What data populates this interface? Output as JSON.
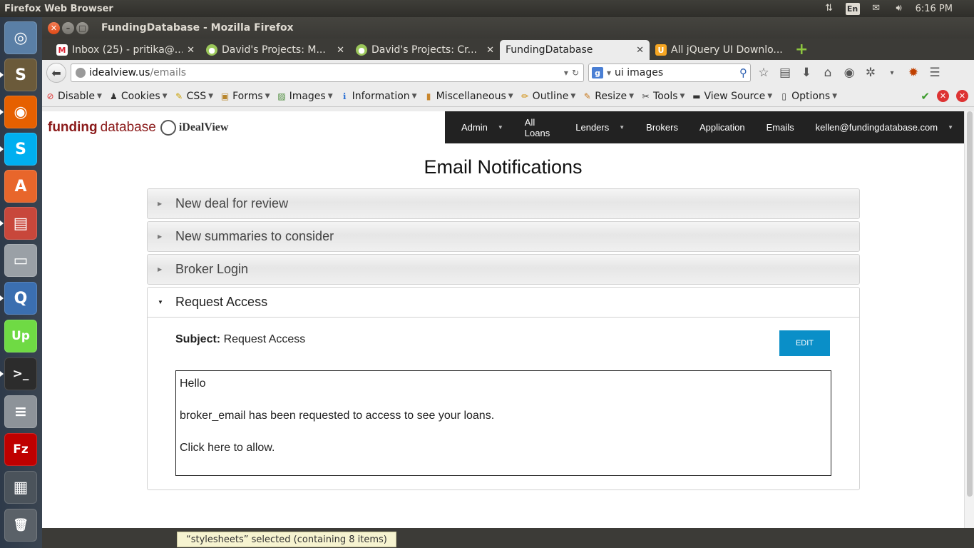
{
  "desktop": {
    "panel_title": "Firefox Web Browser",
    "time": "6:16 PM",
    "keyboard_layout": "En",
    "tray_icons": [
      "network-icon",
      "keyboard-icon",
      "mail-icon",
      "volume-icon"
    ]
  },
  "launcher": {
    "items": [
      {
        "name": "ubuntu-dash-icon",
        "glyph": "◎",
        "color": "#5a7fa6"
      },
      {
        "name": "sublime-text-icon",
        "glyph": "S",
        "color": "#6b5a3a"
      },
      {
        "name": "firefox-icon",
        "glyph": "◉",
        "color": "#e66000"
      },
      {
        "name": "skype-icon",
        "glyph": "S",
        "color": "#00aff0"
      },
      {
        "name": "software-center-icon",
        "glyph": "A",
        "color": "#e8662b"
      },
      {
        "name": "file-manager-icon",
        "glyph": "▤",
        "color": "#c8473b"
      },
      {
        "name": "disk-icon",
        "glyph": "▭",
        "color": "#9aa0a6"
      },
      {
        "name": "quassel-icon",
        "glyph": "Q",
        "color": "#3b6fb0"
      },
      {
        "name": "upwork-icon",
        "glyph": "Up",
        "color": "#6fda44"
      },
      {
        "name": "terminal-icon",
        "glyph": ">_",
        "color": "#2c2c2c"
      },
      {
        "name": "database-icon",
        "glyph": "≡",
        "color": "#8d9399"
      },
      {
        "name": "filezilla-icon",
        "glyph": "Fz",
        "color": "#bf0000"
      },
      {
        "name": "workspace-switcher-icon",
        "glyph": "▦",
        "color": "#4b535b"
      },
      {
        "name": "trash-icon",
        "glyph": "🗑",
        "color": "#5a6168"
      }
    ]
  },
  "window": {
    "title": "FundingDatabase - Mozilla Firefox"
  },
  "tabs": [
    {
      "title": "Inbox (25) - pritika@...",
      "favicon": "gmail-icon",
      "glyph": "M",
      "active": false
    },
    {
      "title": "David's Projects: M...",
      "favicon": "basecamp-icon",
      "glyph": "●",
      "active": false
    },
    {
      "title": "David's Projects: Cr...",
      "favicon": "basecamp-icon",
      "glyph": "●",
      "active": false
    },
    {
      "title": "FundingDatabase",
      "favicon": "",
      "glyph": "",
      "active": true
    },
    {
      "title": "All jQuery UI Downlo...",
      "favicon": "jquery-icon",
      "glyph": "U",
      "active": false
    }
  ],
  "navbar": {
    "url_host": "idealview.us",
    "url_path": "/emails",
    "search_value": "ui images"
  },
  "devbar": {
    "items": [
      {
        "label": "Disable",
        "icon": "⊘",
        "color": "#d33"
      },
      {
        "label": "Cookies",
        "icon": "♟",
        "color": "#333"
      },
      {
        "label": "CSS",
        "icon": "✎",
        "color": "#c9a000"
      },
      {
        "label": "Forms",
        "icon": "▣",
        "color": "#b8862d"
      },
      {
        "label": "Images",
        "icon": "▨",
        "color": "#4a8a3a"
      },
      {
        "label": "Information",
        "icon": "ℹ",
        "color": "#2a6fd4"
      },
      {
        "label": "Miscellaneous",
        "icon": "▮",
        "color": "#c8862d"
      },
      {
        "label": "Outline",
        "icon": "✏",
        "color": "#d08a00"
      },
      {
        "label": "Resize",
        "icon": "✎",
        "color": "#c87a20"
      },
      {
        "label": "Tools",
        "icon": "✂",
        "color": "#444"
      },
      {
        "label": "View Source",
        "icon": "▬",
        "color": "#333"
      },
      {
        "label": "Options",
        "icon": "▯",
        "color": "#444"
      }
    ]
  },
  "site": {
    "brand_bold": "funding",
    "brand_rest": "database",
    "brand_partner": "iDealView",
    "nav": [
      {
        "label": "Admin",
        "dropdown": true
      },
      {
        "label": "All Loans",
        "dropdown": false
      },
      {
        "label": "Lenders",
        "dropdown": true
      },
      {
        "label": "Brokers",
        "dropdown": false
      },
      {
        "label": "Application",
        "dropdown": false
      },
      {
        "label": "Emails",
        "dropdown": false
      },
      {
        "label": "kellen@fundingdatabase.com",
        "dropdown": true
      }
    ],
    "page_title": "Email Notifications",
    "accordion": [
      {
        "label": "New deal for review",
        "open": false
      },
      {
        "label": "New summaries to consider",
        "open": false
      },
      {
        "label": "Broker Login",
        "open": false
      },
      {
        "label": "Request Access",
        "open": true
      }
    ],
    "panel": {
      "subject_label": "Subject:",
      "subject_value": "Request Access",
      "edit_label": "EDIT",
      "body_lines": [
        "Hello",
        "broker_email has been requested to access to see your loans.",
        "Click here to allow."
      ]
    }
  },
  "statusbar": {
    "text": "“stylesheets” selected  (containing 8 items)"
  },
  "colors": {
    "brand_red": "#8b1a1a",
    "nav_dark": "#222222",
    "edit_blue": "#0a8fc8"
  }
}
